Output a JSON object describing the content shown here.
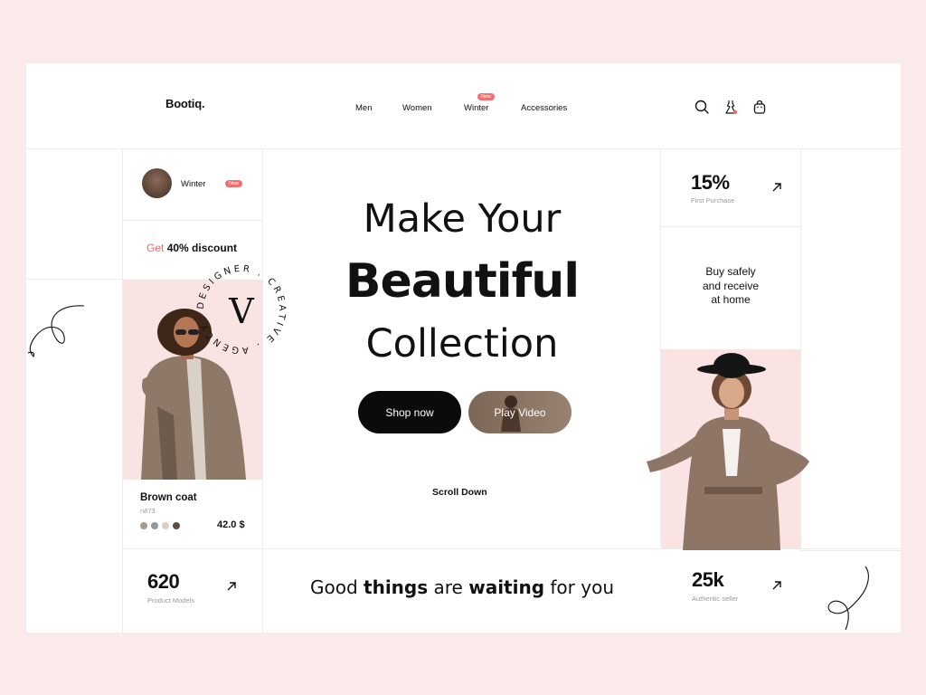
{
  "brand": "Bootiq.",
  "nav": [
    {
      "label": "Men"
    },
    {
      "label": "Women"
    },
    {
      "label": "Winter",
      "badge": "New"
    },
    {
      "label": "Accessories"
    }
  ],
  "header_icons": [
    "search-icon",
    "dress-icon",
    "shopping-bag-icon"
  ],
  "promo": {
    "label": "Winter",
    "badge": "New"
  },
  "discount": {
    "prefix": "Get",
    "text": "40% discount"
  },
  "hero": {
    "line1": "Make Your",
    "line2": "Beautiful",
    "line3": "Collection",
    "primary_button": "Shop now",
    "secondary_button": "Play Video",
    "scroll_label": "Scroll Down"
  },
  "circular_text": "DESIGNER . CREATIVE . AGENCY",
  "circle_letter": "V",
  "product": {
    "name": "Brown coat",
    "code": "n873",
    "price": "42.0 $",
    "swatches": [
      "#a8998c",
      "#8d9b9c",
      "#d9cfc3",
      "#5e4d44"
    ]
  },
  "stats": {
    "first_purchase": {
      "value": "15%",
      "label": "First Purchase"
    },
    "product_models": {
      "value": "620",
      "label": "Product Models"
    },
    "authentic_seller": {
      "value": "25k",
      "label": "Authentic seller"
    }
  },
  "safety": {
    "line1": "Buy safely",
    "line2": "and receive",
    "line3": "at home"
  },
  "tagline": {
    "p1": "Good ",
    "b1": "things",
    "p2": " are ",
    "b2": "waiting",
    "p3": " for you"
  },
  "colors": {
    "page_bg": "#fbeaea",
    "accent": "#ef6b6b",
    "primary_button": "#0b0b0b",
    "secondary_button": "#8a7362",
    "photo_bg": "#f9e3e3"
  }
}
